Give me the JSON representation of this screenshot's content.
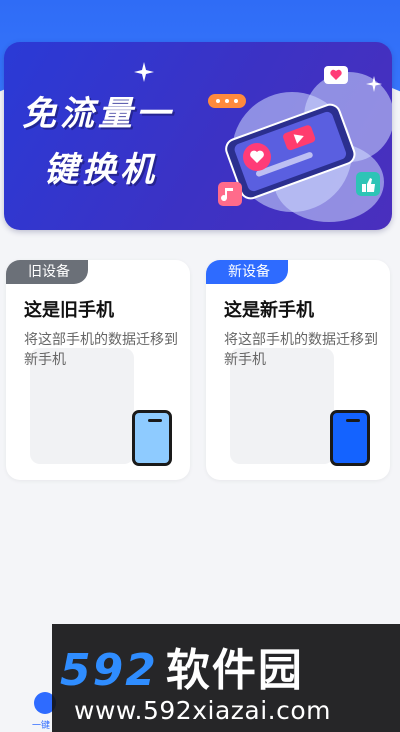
{
  "banner": {
    "title_line1": "免流量一",
    "title_line2": "键换机"
  },
  "cards": [
    {
      "tag": "旧设备",
      "title": "这是旧手机",
      "description": "将这部手机的数据迁移到新手机"
    },
    {
      "tag": "新设备",
      "title": "这是新手机",
      "description": "将这部手机的数据迁移到新手机"
    }
  ],
  "bottom_nav": {
    "label": "一键"
  },
  "watermark": {
    "number": "592",
    "name": "软件园",
    "url": "www.592xiazai.com"
  },
  "colors": {
    "primary": "#2e6bff",
    "old_tag": "#6b7078",
    "old_phone": "#8ecbff",
    "new_phone": "#1463ff"
  }
}
